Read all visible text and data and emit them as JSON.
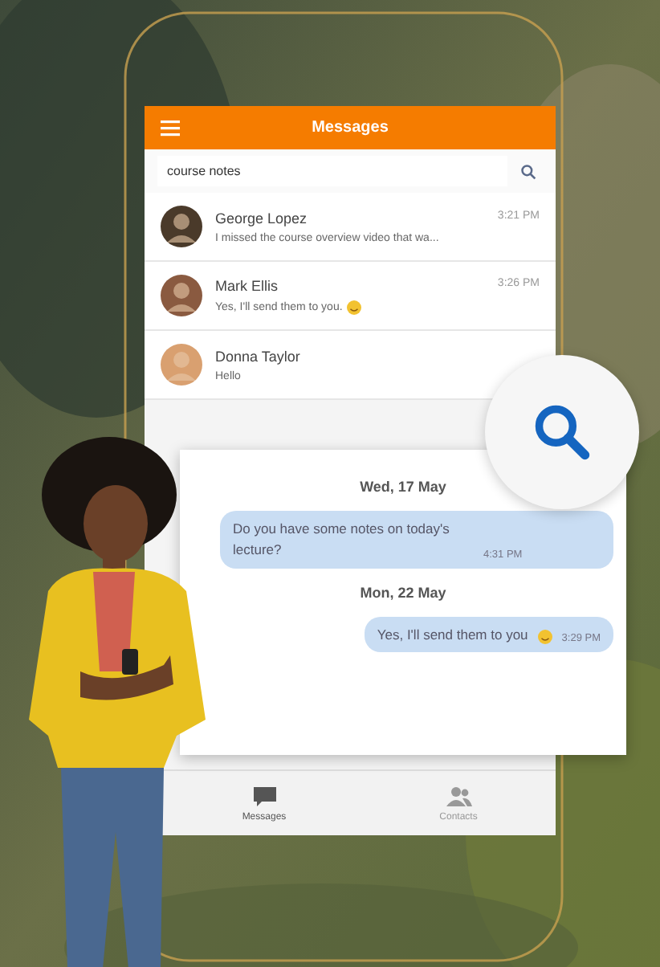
{
  "header": {
    "title": "Messages"
  },
  "search": {
    "value": "course notes"
  },
  "conversations": [
    {
      "name": "George Lopez",
      "time": "3:21 PM",
      "preview": "I missed the course overview video that wa...",
      "emoji": false
    },
    {
      "name": "Mark Ellis",
      "time": "3:26 PM",
      "preview": "Yes, I'll send them to you.",
      "emoji": true
    },
    {
      "name": "Donna Taylor",
      "preview": "Hello",
      "emoji": false
    }
  ],
  "chat": [
    {
      "date": "Wed, 17 May",
      "messages": [
        {
          "text": "Do you have some notes on today's lecture?",
          "time": "4:31 PM",
          "emoji": false,
          "wide": true
        }
      ]
    },
    {
      "date": "Mon, 22 May",
      "messages": [
        {
          "text": "Yes, I'll send them to you",
          "time": "3:29 PM",
          "emoji": true,
          "wide": false
        }
      ]
    }
  ],
  "tabs": [
    {
      "label": "Messages",
      "kind": "chat",
      "selected": true
    },
    {
      "label": "Contacts",
      "kind": "contacts",
      "selected": false
    }
  ]
}
